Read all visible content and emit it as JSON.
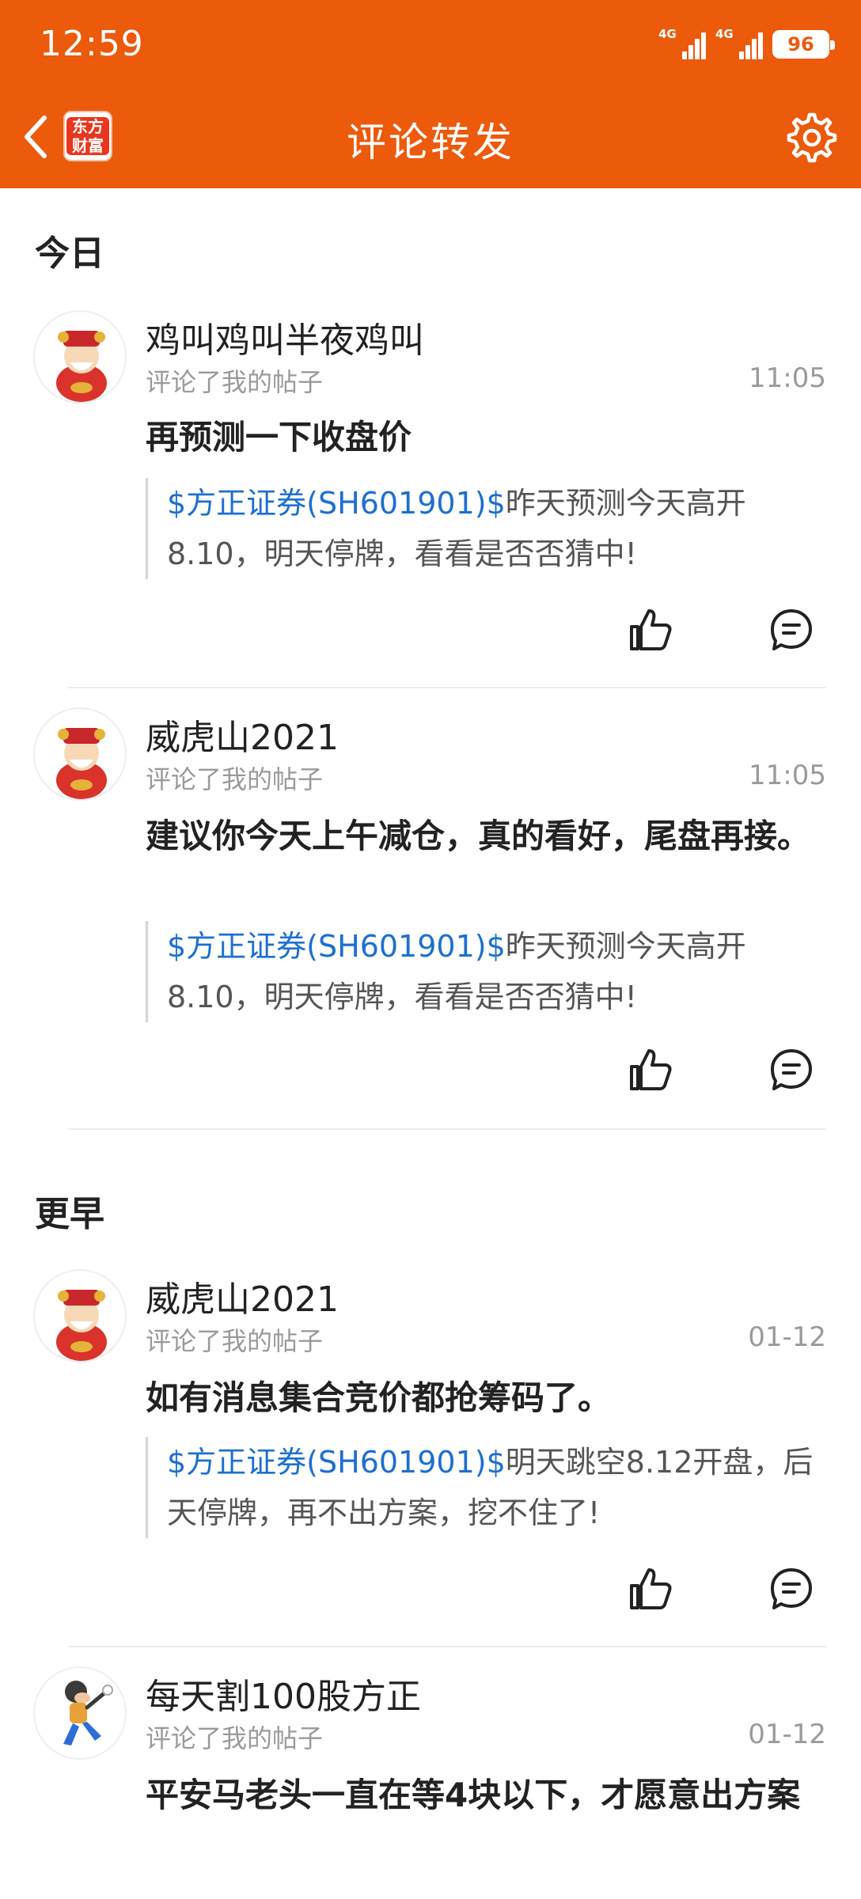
{
  "status_bar": {
    "time": "12:59",
    "net1": "4G",
    "net2": "4G",
    "battery": "96"
  },
  "header": {
    "title": "评论转发",
    "logo_line1": "东方",
    "logo_line2": "财富",
    "icons": {
      "back": "back-arrow-icon",
      "settings": "gear-icon"
    }
  },
  "colors": {
    "brand": "#EC5A0C",
    "stock_link": "#1E6FD0"
  },
  "sections": [
    {
      "title": "今日",
      "items": [
        {
          "username": "鸡叫鸡叫半夜鸡叫",
          "action": "评论了我的帖子",
          "time": "11:05",
          "comment": "再预测一下收盘价",
          "quote_stock": "$方正证券(SH601901)$",
          "quote_text": "昨天预测今天高开8.10，明天停牌，看看是否否猜中!"
        },
        {
          "username": "威虎山2021",
          "action": "评论了我的帖子",
          "time": "11:05",
          "comment": "建议你今天上午减仓，真的看好，尾盘再接。",
          "quote_stock": "$方正证券(SH601901)$",
          "quote_text": "昨天预测今天高开8.10，明天停牌，看看是否否猜中!"
        }
      ]
    },
    {
      "title": "更早",
      "items": [
        {
          "username": "威虎山2021",
          "action": "评论了我的帖子",
          "time": "01-12",
          "comment": "如有消息集合竞价都抢筹码了。",
          "quote_stock": "$方正证券(SH601901)$",
          "quote_text": "明天跳空8.12开盘，后天停牌，再不出方案，挖不住了!"
        },
        {
          "username": "每天割100股方正",
          "action": "评论了我的帖子",
          "time": "01-12",
          "comment": "平安马老头一直在等4块以下，才愿意出方案"
        }
      ]
    }
  ]
}
